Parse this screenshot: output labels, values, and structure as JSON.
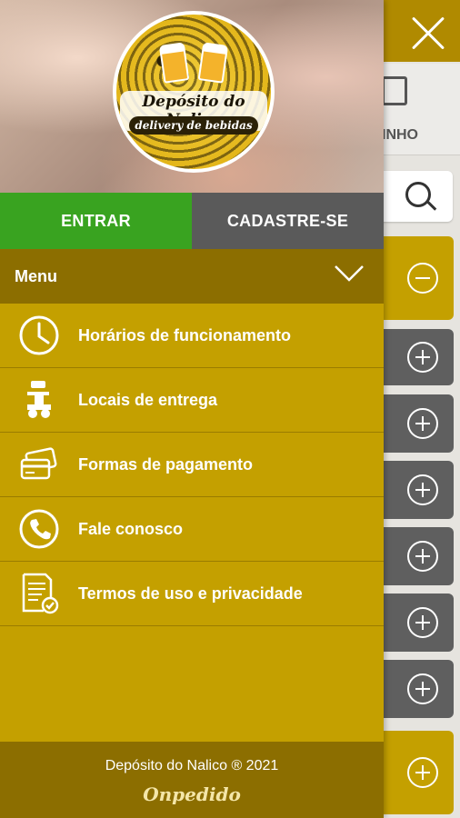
{
  "background": {
    "cart_label": "INHO"
  },
  "logo": {
    "title": "Depósito do Nalico",
    "subtitle": "delivery de bebidas"
  },
  "auth": {
    "login_label": "ENTRAR",
    "signup_label": "CADASTRE-SE"
  },
  "menu": {
    "title": "Menu",
    "items": [
      {
        "label": "Horários de funcionamento",
        "icon": "clock-icon"
      },
      {
        "label": "Locais de entrega",
        "icon": "scooter-icon"
      },
      {
        "label": "Formas de pagamento",
        "icon": "credit-cards-icon"
      },
      {
        "label": "Fale conosco",
        "icon": "phone-icon"
      },
      {
        "label": "Termos de uso e privacidade",
        "icon": "document-check-icon"
      }
    ]
  },
  "footer": {
    "copyright": "Depósito do Nalico ® 2021",
    "brand": "Onpedido"
  },
  "colors": {
    "drawer": "#c4a000",
    "header_dark": "#8c6e00",
    "login_green": "#39a320",
    "signup_gray": "#5a5a5a",
    "tile_gray": "#5f5f5f",
    "tile_gold": "#c4a000"
  }
}
